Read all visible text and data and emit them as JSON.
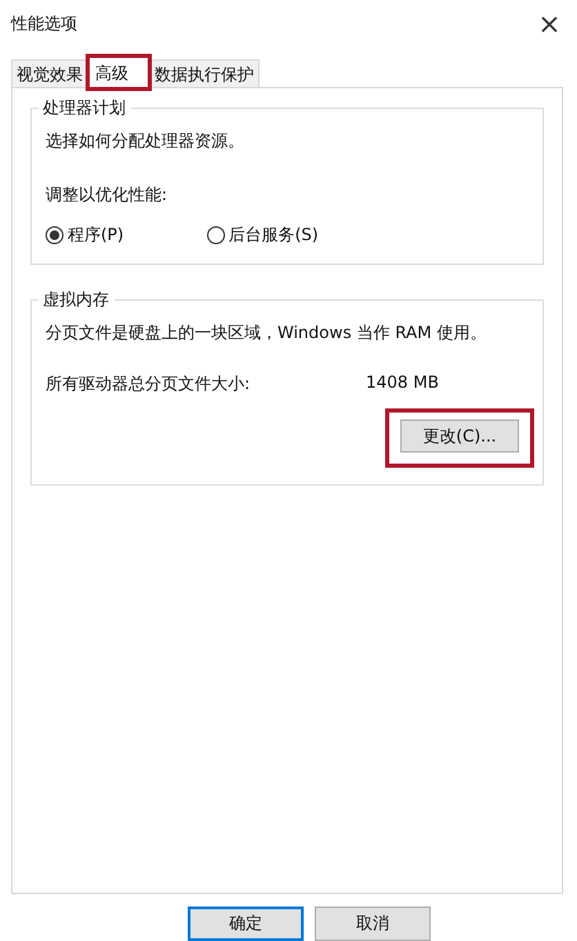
{
  "window": {
    "title": "性能选项",
    "close": "×"
  },
  "tabs": [
    {
      "label": "视觉效果",
      "selected": false,
      "highlighted": false
    },
    {
      "label": "高级",
      "selected": true,
      "highlighted": true
    },
    {
      "label": "数据执行保护",
      "selected": false,
      "highlighted": false
    }
  ],
  "processor_group": {
    "title": "处理器计划",
    "description": "选择如何分配处理器资源。",
    "prompt": "调整以优化性能:",
    "options": [
      {
        "label": "程序(P)",
        "selected": true
      },
      {
        "label": "后台服务(S)",
        "selected": false
      }
    ]
  },
  "memory_group": {
    "title": "虚拟内存",
    "description": "分页文件是硬盘上的一块区域，Windows 当作 RAM 使用。",
    "size_label": "所有驱动器总分页文件大小:",
    "size_value": "1408 MB",
    "change_button": {
      "label": "更改(C)...",
      "highlighted": true
    }
  },
  "buttons": [
    {
      "label": "确定",
      "kind": "default"
    },
    {
      "label": "取消",
      "kind": "normal"
    }
  ]
}
